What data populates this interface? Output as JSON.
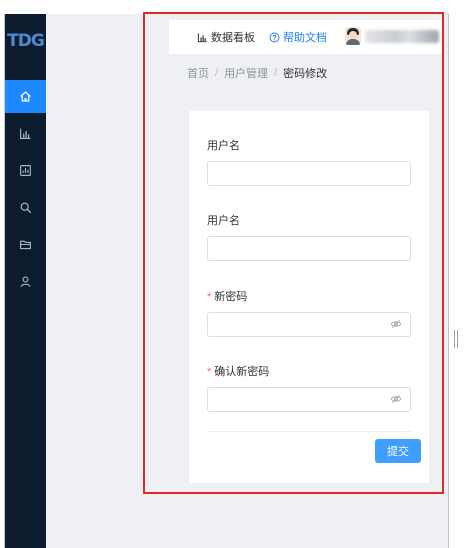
{
  "logo": "TDG",
  "sidebar": {
    "items": [
      {
        "icon": "home-icon",
        "active": true
      },
      {
        "icon": "bar-chart-icon",
        "active": false
      },
      {
        "icon": "report-icon",
        "active": false
      },
      {
        "icon": "search-icon",
        "active": false
      },
      {
        "icon": "folder-icon",
        "active": false
      },
      {
        "icon": "user-icon",
        "active": false
      }
    ]
  },
  "header": {
    "dashboard_label": "数据看板",
    "help_label": "帮助文档",
    "user_name": ""
  },
  "breadcrumb": [
    "首页",
    "用户管理",
    "密码修改"
  ],
  "form": {
    "fields": [
      {
        "label": "用户名",
        "required": false,
        "value": "",
        "type": "text"
      },
      {
        "label": "用户名",
        "required": false,
        "value": "",
        "type": "text"
      },
      {
        "label": "新密码",
        "required": true,
        "value": "",
        "type": "password"
      },
      {
        "label": "确认新密码",
        "required": true,
        "value": "",
        "type": "password"
      }
    ],
    "required_mark": "*",
    "submit_label": "提交"
  },
  "colors": {
    "sidebar_bg": "#0d1b2e",
    "active_nav": "#1e88ff",
    "primary_button": "#409eff",
    "link": "#1e80ff",
    "required": "#f56c6c",
    "annotation_box": "#e02a2a"
  }
}
